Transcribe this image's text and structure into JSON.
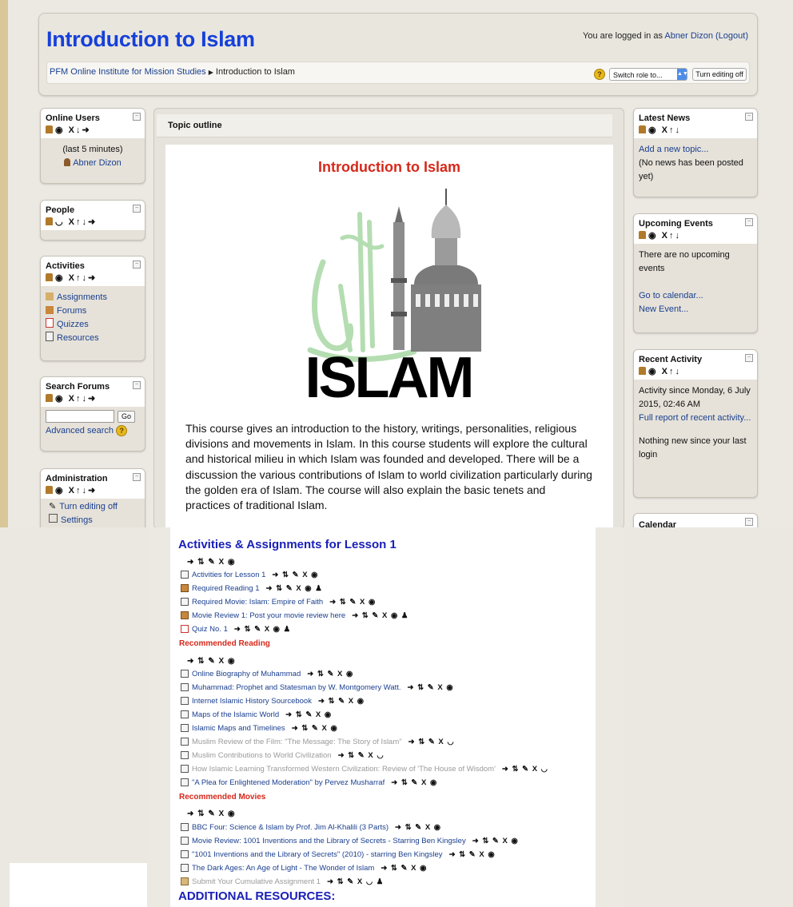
{
  "header": {
    "course_title": "Introduction to Islam",
    "login_prefix": "You are logged in as ",
    "login_user": "Abner Dizon",
    "logout_label": "(Logout)",
    "breadcrumb_root": "PFM Online Institute for Mission Studies",
    "breadcrumb_sep": "▶",
    "breadcrumb_current": "Introduction to Islam",
    "switch_role": "Switch role to...",
    "turn_editing_off": "Turn editing off"
  },
  "left": {
    "online_users": {
      "title": "Online Users",
      "note": "(last 5 minutes)",
      "user": "Abner Dizon"
    },
    "people": {
      "title": "People"
    },
    "activities": {
      "title": "Activities",
      "items": [
        "Assignments",
        "Forums",
        "Quizzes",
        "Resources"
      ]
    },
    "search": {
      "title": "Search Forums",
      "go": "Go",
      "advanced": "Advanced search"
    },
    "admin": {
      "title": "Administration",
      "turn_editing_off": "Turn editing off",
      "settings": "Settings"
    }
  },
  "right": {
    "latest_news": {
      "title": "Latest News",
      "add": "Add a new topic...",
      "note": "(No news has been posted yet)"
    },
    "upcoming": {
      "title": "Upcoming Events",
      "note": "There are no upcoming events",
      "calendar": "Go to calendar...",
      "new_event": "New Event..."
    },
    "recent": {
      "title": "Recent Activity",
      "since": "Activity since Monday, 6 July 2015, 02:46 AM",
      "report": "Full report of recent activity...",
      "nothing": "Nothing new since your last login"
    },
    "calendar": {
      "title": "Calendar"
    }
  },
  "main": {
    "topic_outline": "Topic outline",
    "heading": "Introduction to Islam",
    "image_word": "ISLAM",
    "description": "This course gives an introduction to the history, writings, personalities, religious divisions and movements in Islam. In this course students will explore the cultural and historical milieu in which Islam was founded and developed. There will be a discussion the various contributions of Islam to world civilization particularly during the golden era of Islam. The course will also explain the basic tenets and practices of traditional Islam."
  },
  "lesson": {
    "heading": "Activities & Assignments for Lesson 1",
    "items": [
      "Activities for Lesson 1",
      "Required Reading 1",
      "Required Movie: Islam: Empire of Faith",
      "Movie Review 1: Post your movie review here",
      "Quiz No. 1"
    ],
    "reading_label": "Recommended Reading",
    "reading": [
      "Online Biography of Muhammad",
      "Muhammad: Prophet and Statesman by W. Montgomery Watt.",
      "Internet Islamic History Sourcebook",
      "Maps of the Islamic World",
      "Islamic Maps and Timelines",
      "Muslim Review of the Film: \"The Message: The Story of Islam\"",
      "Muslim Contributions to World Civilization",
      "How Islamic Learning Transformed Western Civilization: Review of 'The House of Wisdom'",
      "\"A Plea for Enlightened Moderation\" by Pervez Musharraf"
    ],
    "movies_label": "Recommended Movies",
    "movies": [
      "BBC Four: Science & Islam by Prof. Jim Al-Khalili (3 Parts)",
      "Movie Review: 1001 Inventions and the Library of Secrets - Starring Ben Kingsley",
      "\"1001 Inventions and the Library of Secrets\" (2010) - starring Ben Kingsley",
      "The Dark Ages: An Age of Light - The Wonder of Islam",
      "Submit Your Cumulative Assignment 1"
    ],
    "additional": "ADDITIONAL RESOURCES:"
  }
}
